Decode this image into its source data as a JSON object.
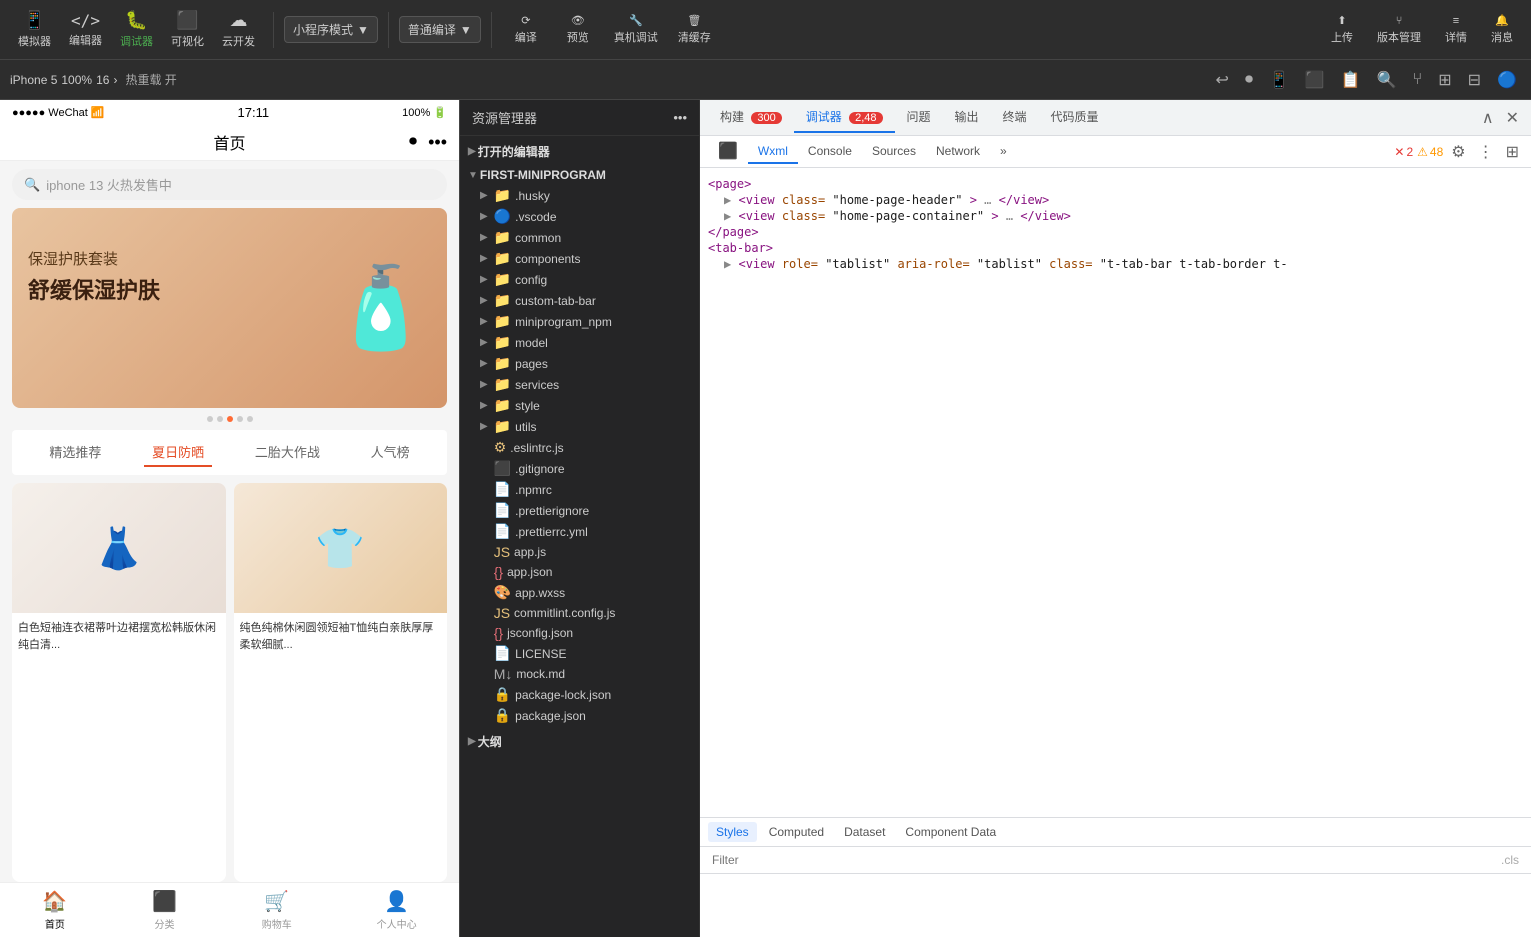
{
  "topToolbar": {
    "modes": [
      {
        "label": "模拟器",
        "icon": "📱",
        "active": false
      },
      {
        "label": "编辑器",
        "icon": "</>",
        "active": false
      },
      {
        "label": "调试器",
        "icon": "🐛",
        "active": true
      },
      {
        "label": "可视化",
        "icon": "⬛",
        "active": false
      },
      {
        "label": "云开发",
        "icon": "☁️",
        "active": false
      }
    ],
    "modeDropdownLabel": "小程序模式",
    "compileDropdownLabel": "普通编译",
    "actions": [
      {
        "label": "编译",
        "icon": "⟳"
      },
      {
        "label": "预览",
        "icon": "👁"
      },
      {
        "label": "真机调试",
        "icon": "🔧"
      },
      {
        "label": "清缓存",
        "icon": "🗄"
      }
    ],
    "rightActions": [
      {
        "label": "上传",
        "icon": "⬆"
      },
      {
        "label": "版本管理",
        "icon": "⑂"
      },
      {
        "label": "详情",
        "icon": "≡"
      },
      {
        "label": "消息",
        "icon": "🔔"
      }
    ]
  },
  "secondToolbar": {
    "deviceLabel": "iPhone 5",
    "zoomLabel": "100%",
    "pageLabel": "16",
    "hotReloadLabel": "热重载 开",
    "icons": [
      "↩",
      "⏺",
      "📱",
      "⬛",
      "📋",
      "🔍",
      "⑂",
      "⬛",
      "⬛",
      "🔵"
    ]
  },
  "simulator": {
    "statusBar": {
      "left": "●●●●● WeChat 📶",
      "center": "17:11",
      "right": "100% 🔋"
    },
    "navTitle": "首页",
    "searchPlaceholder": "iphone 13 火热发售中",
    "banner": {
      "line1": "保湿护肤套装",
      "line2": "舒缓保湿护肤"
    },
    "tabs": [
      "精选推荐",
      "夏日防晒",
      "二胎大作战",
      "人气榜"
    ],
    "activeTab": 1,
    "products": [
      {
        "title": "白色短袖连衣裙蒂叶边裙摆宽松韩版休闲纯白清..."
      },
      {
        "title": "纯色纯棉休闲圆领短袖T恤纯白亲肤厚厚柔软细腻..."
      }
    ],
    "bottomNav": [
      {
        "label": "首页",
        "icon": "🏠",
        "active": true
      },
      {
        "label": "分类",
        "icon": "⬛"
      },
      {
        "label": "购物车",
        "icon": "🛒"
      },
      {
        "label": "个人中心",
        "icon": "👤"
      }
    ]
  },
  "fileExplorer": {
    "title": "资源管理器",
    "openEditorsLabel": "打开的编辑器",
    "rootFolder": "FIRST-MINIPROGRAM",
    "items": [
      {
        "name": ".husky",
        "type": "folder",
        "indent": 1
      },
      {
        "name": ".vscode",
        "type": "folder-vscode",
        "indent": 1
      },
      {
        "name": "common",
        "type": "folder",
        "indent": 1
      },
      {
        "name": "components",
        "type": "folder-components",
        "indent": 1
      },
      {
        "name": "config",
        "type": "folder",
        "indent": 1
      },
      {
        "name": "custom-tab-bar",
        "type": "folder",
        "indent": 1
      },
      {
        "name": "miniprogram_npm",
        "type": "folder",
        "indent": 1
      },
      {
        "name": "model",
        "type": "folder-red",
        "indent": 1
      },
      {
        "name": "pages",
        "type": "folder-red",
        "indent": 1
      },
      {
        "name": "services",
        "type": "folder",
        "indent": 1
      },
      {
        "name": "style",
        "type": "folder",
        "indent": 1
      },
      {
        "name": "utils",
        "type": "folder",
        "indent": 1
      },
      {
        "name": ".eslintrc.js",
        "type": "js",
        "indent": 1
      },
      {
        "name": ".gitignore",
        "type": "git",
        "indent": 1
      },
      {
        "name": ".npmrc",
        "type": "file",
        "indent": 1
      },
      {
        "name": ".prettierignore",
        "type": "file-light",
        "indent": 1
      },
      {
        "name": ".prettierrc.yml",
        "type": "yml",
        "indent": 1
      },
      {
        "name": "app.js",
        "type": "js",
        "indent": 1
      },
      {
        "name": "app.json",
        "type": "json",
        "indent": 1
      },
      {
        "name": "app.wxss",
        "type": "wxss",
        "indent": 1
      },
      {
        "name": "commitlint.config.js",
        "type": "js",
        "indent": 1
      },
      {
        "name": "jsconfig.json",
        "type": "json",
        "indent": 1
      },
      {
        "name": "LICENSE",
        "type": "file-red",
        "indent": 1
      },
      {
        "name": "mock.md",
        "type": "md",
        "indent": 1
      },
      {
        "name": "package-lock.json",
        "type": "lock",
        "indent": 1
      },
      {
        "name": "package.json",
        "type": "lock",
        "indent": 1
      }
    ],
    "moreLabel": "大纲"
  },
  "devtools": {
    "tabs": [
      {
        "label": "构建",
        "badge": "300",
        "badgeColor": "red"
      },
      {
        "label": "调试器",
        "badge": "2,48",
        "badgeColor": "red"
      },
      {
        "label": "问题"
      },
      {
        "label": "输出"
      },
      {
        "label": "终端"
      },
      {
        "label": "代码质量"
      }
    ],
    "activeTab": 1,
    "secondaryTabs": [
      "Wxml",
      "Console",
      "Sources",
      "Network"
    ],
    "activeSecondaryTab": 0,
    "domTree": [
      {
        "text": "<page>",
        "indent": 0,
        "type": "open"
      },
      {
        "text": "▶ <view class=\"home-page-header\">…</view>",
        "indent": 1,
        "type": "collapsed"
      },
      {
        "text": "▶ <view class=\"home-page-container\">…</view>",
        "indent": 1,
        "type": "collapsed"
      },
      {
        "text": "</page>",
        "indent": 0,
        "type": "close"
      },
      {
        "text": "<tab-bar>",
        "indent": 0,
        "type": "open"
      },
      {
        "text": "▶ <view role=\"tablist\" aria-role=\"tablist\" class=\"t-tab-bar t-tab-border t-...",
        "indent": 1,
        "type": "collapsed"
      }
    ],
    "stylesTabs": [
      "Styles",
      "Computed",
      "Dataset",
      "Component Data"
    ],
    "activeStylesTab": 0,
    "filterPlaceholder": "Filter",
    "filterHint": ".cls",
    "errorCount": "2",
    "warnCount": "48"
  }
}
